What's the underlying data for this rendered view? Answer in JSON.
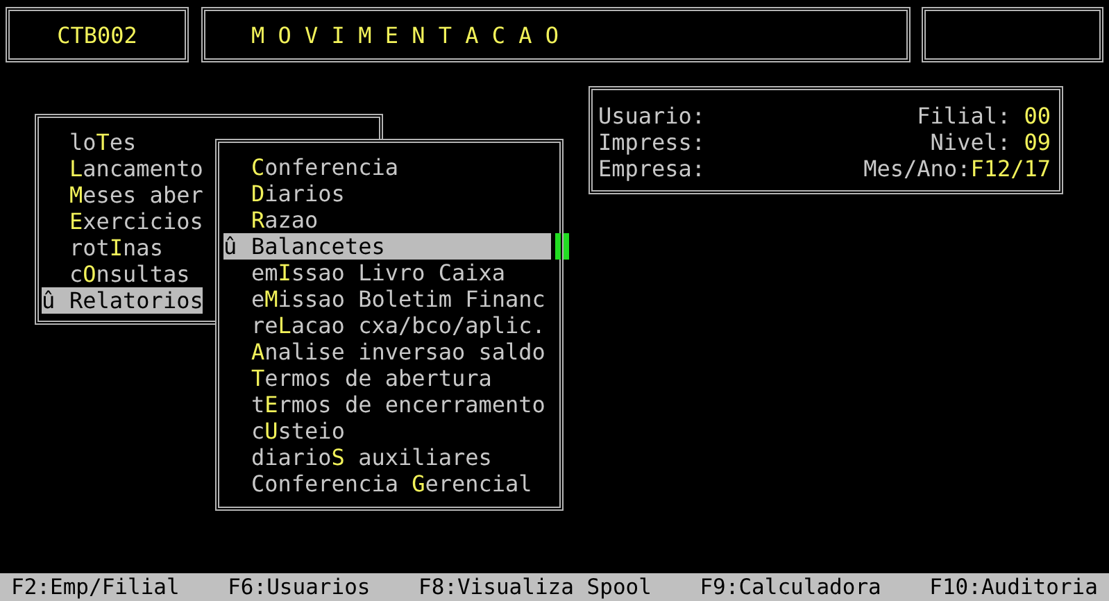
{
  "header": {
    "program_code": "CTB002",
    "title": "M O V I M E N T A C A O"
  },
  "main_menu": {
    "marker": "û",
    "items": [
      {
        "pre": "lo",
        "key": "T",
        "post": "es",
        "selected": false
      },
      {
        "key": "L",
        "post": "ancamento",
        "selected": false
      },
      {
        "key": "M",
        "post": "eses aber",
        "selected": false
      },
      {
        "key": "E",
        "post": "xercicios",
        "selected": false
      },
      {
        "pre": "rot",
        "key": "I",
        "post": "nas",
        "selected": false
      },
      {
        "pre": "c",
        "key": "O",
        "post": "nsultas",
        "selected": false
      },
      {
        "key": "R",
        "post": "elatorios",
        "selected": true
      }
    ]
  },
  "submenu": {
    "marker": "û",
    "items": [
      {
        "key": "C",
        "post": "onferencia",
        "selected": false
      },
      {
        "key": "D",
        "post": "iarios",
        "selected": false
      },
      {
        "key": "R",
        "post": "azao",
        "selected": false
      },
      {
        "key": "B",
        "post": "alancetes",
        "selected": true
      },
      {
        "pre": "em",
        "key": "I",
        "post": "ssao Livro Caixa",
        "selected": false
      },
      {
        "pre": "e",
        "key": "M",
        "post": "issao Boletim Financ",
        "selected": false
      },
      {
        "pre": "re",
        "key": "L",
        "post": "acao cxa/bco/aplic.",
        "selected": false
      },
      {
        "key": "A",
        "post": "nalise inversao saldo",
        "selected": false
      },
      {
        "key": "T",
        "post": "ermos de abertura",
        "selected": false
      },
      {
        "pre": "t",
        "key": "E",
        "post": "rmos de encerramento",
        "selected": false
      },
      {
        "pre": "c",
        "key": "U",
        "post": "steio",
        "selected": false
      },
      {
        "pre": "diario",
        "key": "S",
        "post": " auxiliares",
        "selected": false
      },
      {
        "pre": "Conferencia ",
        "key": "G",
        "post": "erencial",
        "selected": false
      }
    ]
  },
  "info_panel": {
    "rows": [
      {
        "label": "Usuario:",
        "right_label": "Filial:",
        "value": " 00"
      },
      {
        "label": "Impress:",
        "right_label": "Nivel:",
        "value": " 09"
      },
      {
        "label": "Empresa:",
        "right_label": "Mes/Ano:",
        "value": "F12/17"
      }
    ]
  },
  "status_bar": [
    "F2:Emp/Filial",
    "F6:Usuarios",
    "F8:Visualiza Spool",
    "F9:Calculadora",
    "F10:Auditoria"
  ]
}
